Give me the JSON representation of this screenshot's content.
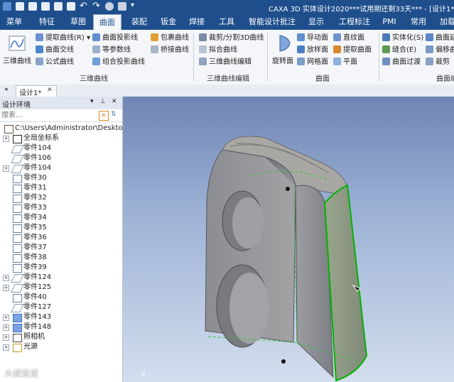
{
  "title": "CAXA 3D 实体设计2020***试用期还剩33天*** - [设计1*]",
  "menu_tabs": [
    "菜单",
    "特征",
    "草图",
    "曲面",
    "装配",
    "钣金",
    "焊接",
    "工具",
    "智能设计批注",
    "显示",
    "工程标注",
    "PMI",
    "常用",
    "加载"
  ],
  "active_tab": "曲面",
  "ribbon": {
    "big_button": "三维曲线",
    "col1": [
      "提取曲线(R)",
      "曲面交线",
      "公式曲线"
    ],
    "col2": [
      "曲面投影线",
      "等参数线",
      "组合投影曲线"
    ],
    "col3": [
      "包裹曲线",
      "桥接曲线"
    ],
    "group1": "三维曲线",
    "col4": [
      "裁剪/分割3D曲线",
      "拟合曲线",
      "三维曲线编辑"
    ],
    "group2": "三维曲线编辑",
    "big_button2": "旋转面",
    "col5": [
      "导动面",
      "放样面",
      "网格面"
    ],
    "col6": [
      "直纹面",
      "提取曲面",
      "平面"
    ],
    "group3": "曲面",
    "col7": [
      "实体化(S)",
      "缝合(E)",
      "曲面过渡"
    ],
    "col8": [
      "曲面延伸",
      "偏移曲面",
      "裁剪"
    ],
    "group4": "曲面编辑"
  },
  "doc_tab": "设计1*",
  "panel": {
    "title": "设计环境",
    "pin": "▾ 📌 ✕",
    "search_placeholder": "搜索...",
    "tree": [
      {
        "label": "C:\\Users\\Administrator\\Desktop\\",
        "type": "root",
        "expander": "",
        "indent": 0
      },
      {
        "label": "全局坐标系",
        "type": "axis",
        "expander": "+",
        "indent": 1
      },
      {
        "label": "零件104",
        "type": "surf",
        "expander": "",
        "indent": 1
      },
      {
        "label": "零件106",
        "type": "surf",
        "expander": "",
        "indent": 1
      },
      {
        "label": "零件104",
        "type": "surf",
        "expander": "+",
        "indent": 1
      },
      {
        "label": "零件30",
        "type": "sketch",
        "expander": "",
        "indent": 1
      },
      {
        "label": "零件31",
        "type": "sketch",
        "expander": "",
        "indent": 1
      },
      {
        "label": "零件32",
        "type": "sketch",
        "expander": "",
        "indent": 1
      },
      {
        "label": "零件33",
        "type": "sketch",
        "expander": "",
        "indent": 1
      },
      {
        "label": "零件34",
        "type": "sketch",
        "expander": "",
        "indent": 1
      },
      {
        "label": "零件35",
        "type": "sketch",
        "expander": "",
        "indent": 1
      },
      {
        "label": "零件36",
        "type": "sketch",
        "expander": "",
        "indent": 1
      },
      {
        "label": "零件37",
        "type": "sketch",
        "expander": "",
        "indent": 1
      },
      {
        "label": "零件38",
        "type": "sketch",
        "expander": "",
        "indent": 1
      },
      {
        "label": "零件39",
        "type": "sketch",
        "expander": "",
        "indent": 1
      },
      {
        "label": "零件124",
        "type": "surf",
        "expander": "+",
        "indent": 1
      },
      {
        "label": "零件125",
        "type": "surf",
        "expander": "+",
        "indent": 1
      },
      {
        "label": "零件40",
        "type": "sketch",
        "expander": "",
        "indent": 1
      },
      {
        "label": "零件127",
        "type": "surf",
        "expander": "",
        "indent": 1
      },
      {
        "label": "零件143",
        "type": "solid",
        "expander": "+",
        "indent": 1
      },
      {
        "label": "零件148",
        "type": "solid",
        "expander": "+",
        "indent": 1
      },
      {
        "label": "照相机",
        "type": "camera",
        "expander": "+",
        "indent": 1
      },
      {
        "label": "光源",
        "type": "light",
        "expander": "+",
        "indent": 1
      }
    ]
  },
  "watermark": "大叔说说",
  "axis_label": "Z"
}
